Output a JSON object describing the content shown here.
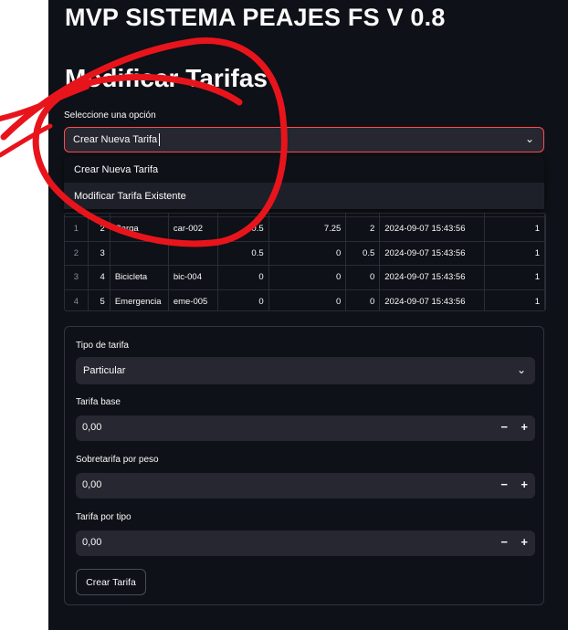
{
  "app_title": "MVP SISTEMA PEAJES FS V 0.8",
  "page_subtitle": "Modificar Tarifas",
  "option_select": {
    "label": "Seleccione una opción",
    "value": "Crear Nueva Tarifa",
    "options": [
      "Crear Nueva Tarifa",
      "Modificar Tarifa Existente"
    ]
  },
  "table": {
    "rows": [
      [
        "1",
        "2",
        "Carga",
        "car-002",
        "0.5",
        "7.25",
        "2",
        "2024-09-07 15:43:56",
        "1"
      ],
      [
        "2",
        "3",
        "",
        "",
        "0.5",
        "0",
        "0.5",
        "2024-09-07 15:43:56",
        "1"
      ],
      [
        "3",
        "4",
        "Bicicleta",
        "bic-004",
        "0",
        "0",
        "0",
        "2024-09-07 15:43:56",
        "1"
      ],
      [
        "4",
        "5",
        "Emergencia",
        "eme-005",
        "0",
        "0",
        "0",
        "2024-09-07 15:43:56",
        "1"
      ]
    ]
  },
  "form": {
    "tipo_label": "Tipo de tarifa",
    "tipo_value": "Particular",
    "base_label": "Tarifa base",
    "base_value": "0,00",
    "peso_label": "Sobretarifa por peso",
    "peso_value": "0,00",
    "tipo_tarifa_label": "Tarifa por tipo",
    "tipo_tarifa_value": "0,00",
    "minus": "−",
    "plus": "+",
    "submit_label": "Crear Tarifa"
  },
  "icons": {
    "chevron": "chevron-down-icon"
  },
  "colors": {
    "background": "#0e1117",
    "input": "#262730",
    "focus_border": "#ff4b4b",
    "scribble": "#e8141c"
  }
}
